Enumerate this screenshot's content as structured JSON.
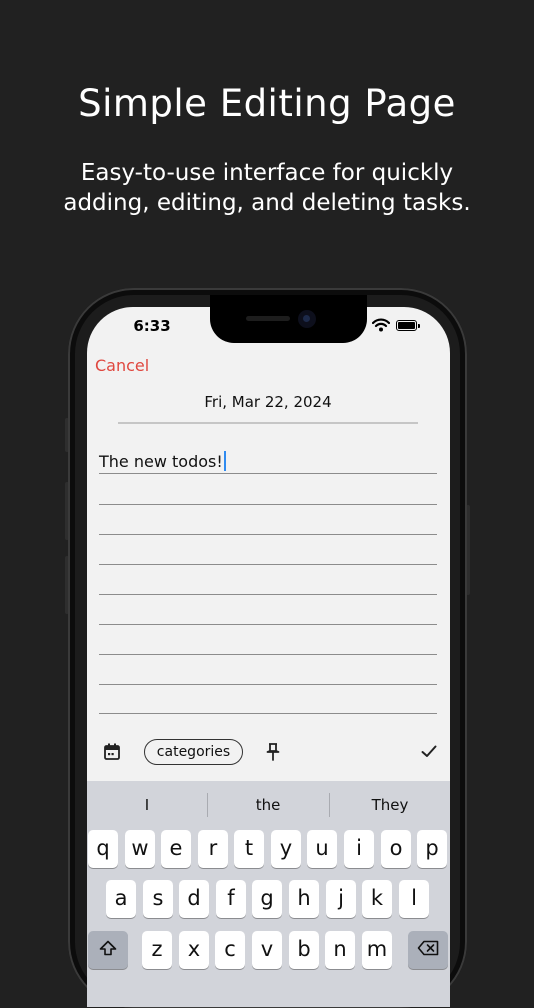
{
  "headline": "Simple Editing Page",
  "subline": {
    "line1": "Easy-to-use interface for quickly",
    "line2": "adding, editing, and deleting tasks."
  },
  "status_bar": {
    "time": "6:33"
  },
  "editor": {
    "cancel_label": "Cancel",
    "date": "Fri, Mar 22, 2024",
    "todo_text": "The new todos!",
    "categories_label": "categories",
    "accent_color": "#e0473f"
  },
  "keyboard": {
    "suggestions": [
      "I",
      "the",
      "They"
    ],
    "row1": [
      "q",
      "w",
      "e",
      "r",
      "t",
      "y",
      "u",
      "i",
      "o",
      "p"
    ],
    "row2": [
      "a",
      "s",
      "d",
      "f",
      "g",
      "h",
      "j",
      "k",
      "l"
    ],
    "row3": [
      "z",
      "x",
      "c",
      "v",
      "b",
      "n",
      "m"
    ]
  }
}
